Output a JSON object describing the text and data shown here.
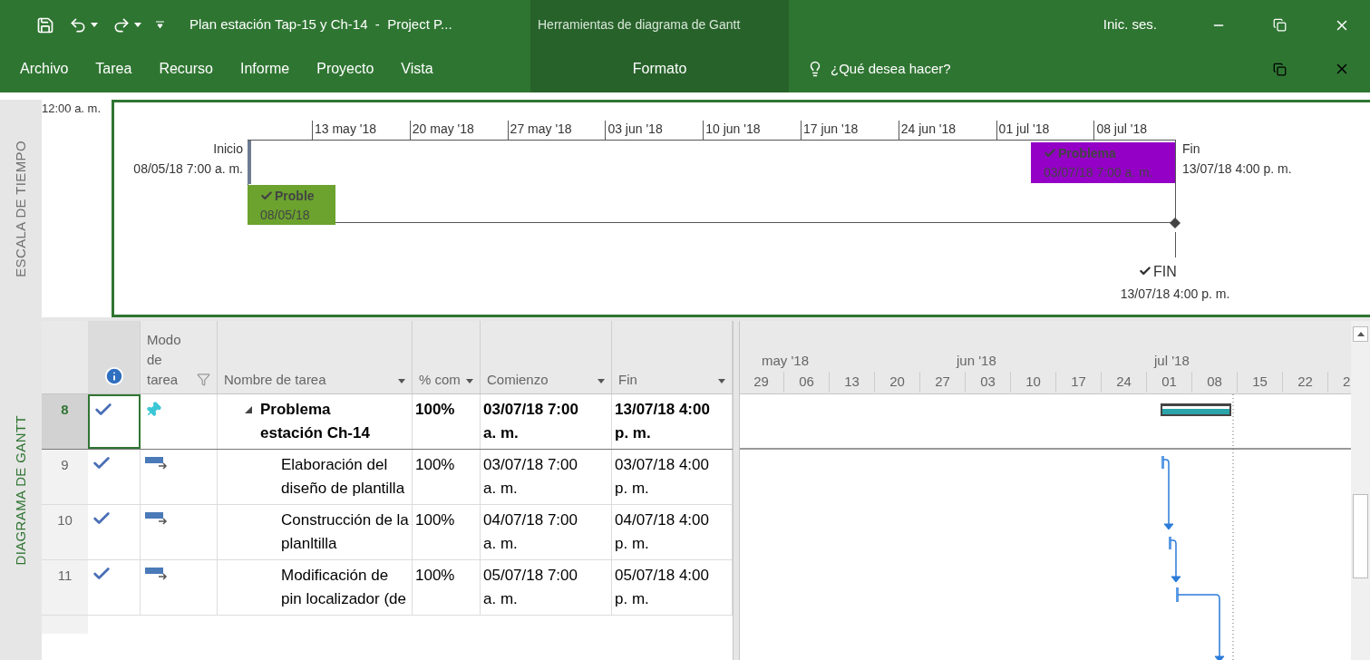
{
  "title_bar": {
    "title": "Plan estación Tap-15 y Ch-14  -  Project P...",
    "context_label": "Herramientas de diagrama de Gantt",
    "account": "Inic. ses."
  },
  "ribbon": {
    "tabs": [
      {
        "label": "Archivo",
        "selected": false,
        "contextual": false
      },
      {
        "label": "Tarea",
        "selected": false,
        "contextual": false
      },
      {
        "label": "Recurso",
        "selected": false,
        "contextual": false
      },
      {
        "label": "Informe",
        "selected": false,
        "contextual": false
      },
      {
        "label": "Proyecto",
        "selected": false,
        "contextual": false
      },
      {
        "label": "Vista",
        "selected": false,
        "contextual": false
      },
      {
        "label": "Formato",
        "selected": false,
        "contextual": true
      }
    ],
    "tell_me": "¿Qué desea hacer?"
  },
  "timeline": {
    "side_label": "ESCALA DE TIEMPO",
    "time_label": "12:00 a. m.",
    "ticks": [
      "13 may '18",
      "20 may '18",
      "27 may '18",
      "03 jun '18",
      "10 jun '18",
      "17 jun '18",
      "24 jun '18",
      "01 jul '18",
      "08 jul '18"
    ],
    "start": {
      "label": "Inicio",
      "date": "08/05/18 7:00 a. m."
    },
    "finish": {
      "label": "Fin",
      "date": "13/07/18 4:00 p. m."
    },
    "bars": [
      {
        "name": "Proble",
        "date": "08/05/18",
        "color": "#6ba32e",
        "checked": true
      },
      {
        "name": "Problema",
        "date": "03/07/18 7:00 a. m.",
        "color": "#9400c6",
        "checked": true
      }
    ],
    "milestone": {
      "name": "FIN",
      "date": "13/07/18 4:00 p. m.",
      "checked": true
    }
  },
  "gantt": {
    "side_label": "DIAGRAMA DE GANTT",
    "columns": [
      {
        "label": "Modo de tarea",
        "kind": "filter"
      },
      {
        "label": "Nombre de tarea",
        "kind": "dropdown"
      },
      {
        "label": "% com",
        "kind": "dropdown"
      },
      {
        "label": "Comienzo",
        "kind": "dropdown"
      },
      {
        "label": "Fin",
        "kind": "dropdown"
      }
    ],
    "timescale": {
      "months": [
        "may '18",
        "jun '18",
        "jul '18"
      ],
      "days": [
        "29",
        "06",
        "13",
        "20",
        "27",
        "03",
        "10",
        "17",
        "24",
        "01",
        "08",
        "15",
        "22",
        "2"
      ]
    },
    "rows": [
      {
        "id": "8",
        "selected": true,
        "complete": true,
        "kind": "manual",
        "summary": true,
        "expanded": true,
        "name": "Problema estación Ch-14",
        "pct": "100%",
        "start": "03/07/18 7:00 a. m.",
        "finish": "13/07/18 4:00 p. m."
      },
      {
        "id": "9",
        "selected": false,
        "complete": true,
        "kind": "auto",
        "summary": false,
        "name": "Elaboración del diseño de plantilla",
        "pct": "100%",
        "start": "03/07/18 7:00 a. m.",
        "finish": "03/07/18 4:00 p. m."
      },
      {
        "id": "10",
        "selected": false,
        "complete": true,
        "kind": "auto",
        "summary": false,
        "name": "Construcción de la planltilla",
        "pct": "100%",
        "start": "04/07/18 7:00 a. m.",
        "finish": "04/07/18 4:00 p. m."
      },
      {
        "id": "11",
        "selected": false,
        "complete": true,
        "kind": "auto",
        "summary": false,
        "name": "Modificación de pin localizador (de",
        "pct": "100%",
        "start": "05/07/18 7:00 a. m.",
        "finish": "05/07/18 4:00 p. m."
      }
    ]
  }
}
